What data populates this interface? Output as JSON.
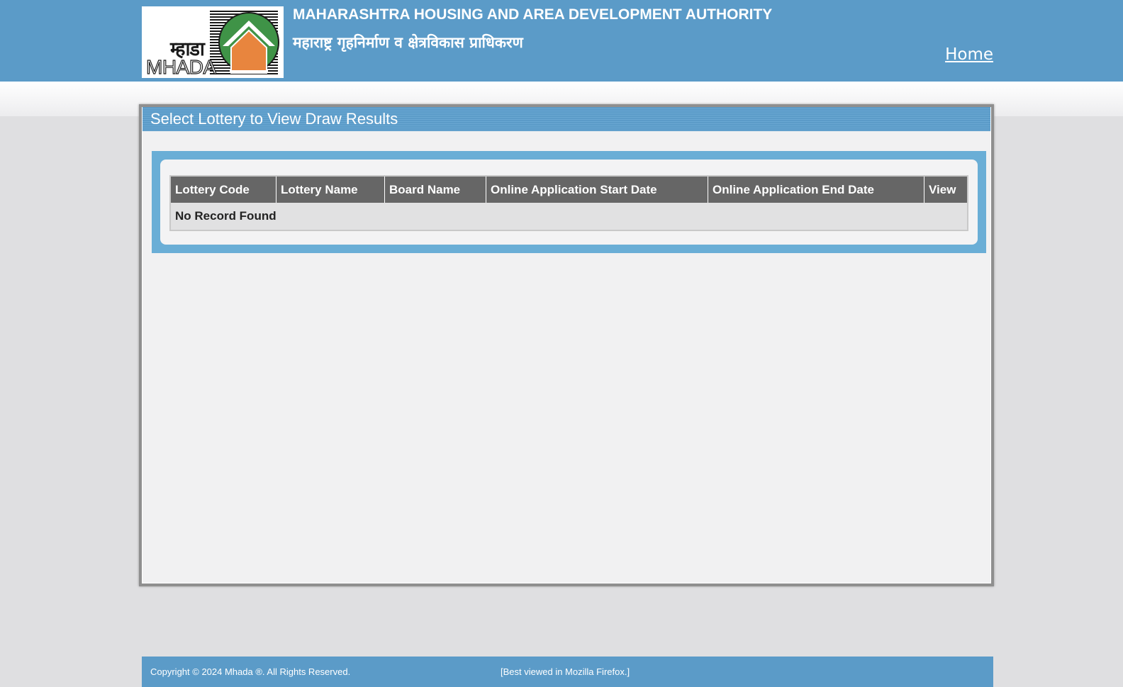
{
  "header": {
    "logo": {
      "text_marathi": "म्हाडा",
      "text_english": "MHADA",
      "brand_green": "#3f9347",
      "brand_orange": "#e8853e"
    },
    "org_name_en": "MAHARASHTRA HOUSING AND AREA DEVELOPMENT AUTHORITY",
    "org_name_mr": "महाराष्ट्र गृहनिर्माण व क्षेत्रविकास प्राधिकरण",
    "home_link": "Home"
  },
  "panel": {
    "title": "Select Lottery to View Draw Results"
  },
  "table": {
    "columns": [
      "Lottery Code",
      "Lottery Name",
      "Board Name",
      "Online Application Start Date",
      "Online Application End Date",
      "View"
    ],
    "empty_message": "No Record Found"
  },
  "footer": {
    "copyright": "Copyright © 2024 Mhada ®. All Rights Reserved.",
    "browser_note": "[Best viewed in Mozilla Firefox.]"
  },
  "colors": {
    "header_blue": "#5b9bc8",
    "frame_blue": "#6aaed6",
    "table_header_gray": "#666666",
    "page_background": "#dfdfe1"
  }
}
